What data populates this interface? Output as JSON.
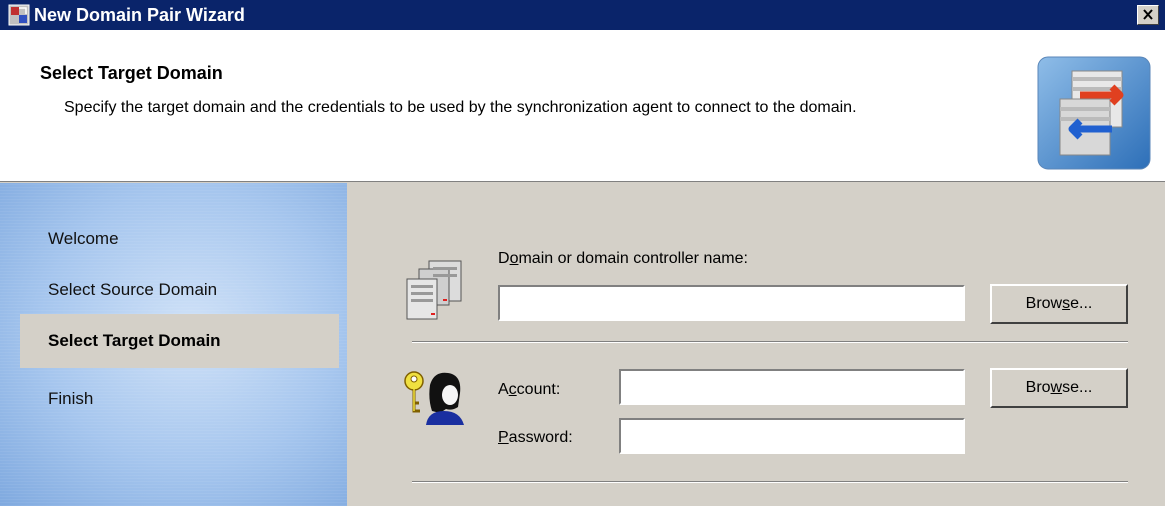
{
  "window": {
    "title": "New Domain Pair Wizard",
    "close_icon": "close-icon"
  },
  "header": {
    "heading": "Select Target Domain",
    "description": "Specify the target domain and the credentials to be used by the synchronization agent to connect to the domain.",
    "icon": "domain-sync-icon"
  },
  "sidebar": {
    "steps": [
      {
        "label": "Welcome",
        "current": false
      },
      {
        "label": "Select Source Domain",
        "current": false
      },
      {
        "label": "Select Target Domain",
        "current": true
      },
      {
        "label": "Finish",
        "current": false
      }
    ]
  },
  "form": {
    "domain": {
      "icon": "server-icon",
      "label_pre": "D",
      "label_mnemonic": "o",
      "label_post": "main or domain controller name:",
      "value": "",
      "browse_pre": "Brow",
      "browse_mnemonic": "s",
      "browse_post": "e..."
    },
    "credentials": {
      "icon": "user-key-icon",
      "account_pre": "A",
      "account_mnemonic": "c",
      "account_post": "count:",
      "account_value": "",
      "browse_pre": "Bro",
      "browse_mnemonic": "w",
      "browse_post": "se...",
      "password_pre": "",
      "password_mnemonic": "P",
      "password_post": "assword:",
      "password_value": ""
    }
  },
  "colors": {
    "titlebar": "#0a246a",
    "face": "#d4d0c8",
    "sidebar": "#a6c6ee"
  }
}
